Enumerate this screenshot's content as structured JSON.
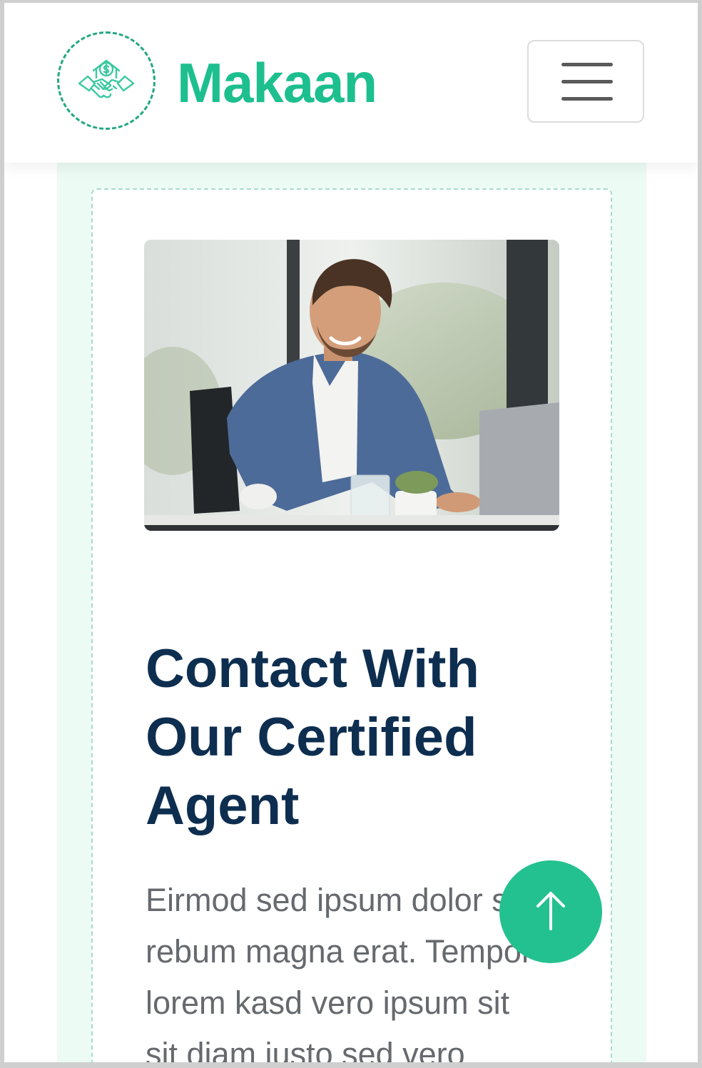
{
  "brand": {
    "name": "Makaan",
    "logo_icon": "handshake-house-money-icon"
  },
  "nav": {
    "toggle_icon": "hamburger-menu-icon"
  },
  "hero": {
    "image_alt": "Smiling agent working on a laptop",
    "heading": "Contact With Our Certified Agent",
    "paragraph": "Eirmod sed ipsum dolor sit rebum magna erat. Tempor lorem kasd vero ipsum sit sit diam justo sed vero"
  },
  "back_to_top": {
    "icon": "arrow-up-icon"
  },
  "colors": {
    "brand": "#1dbf8f",
    "heading": "#0e2e50",
    "text": "#666a6e",
    "panel": "#ecfbf4"
  }
}
